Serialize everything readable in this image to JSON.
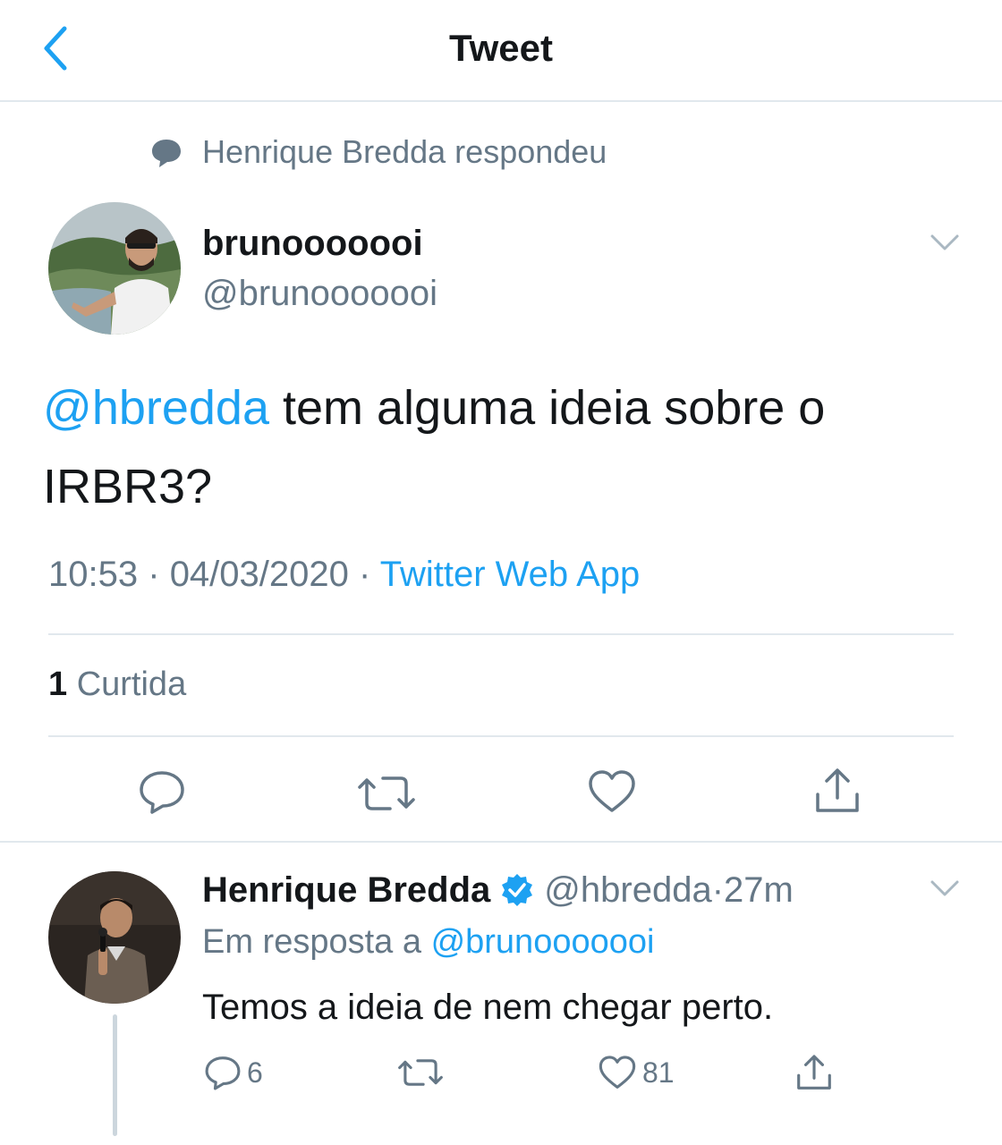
{
  "navbar": {
    "title": "Tweet"
  },
  "context": {
    "text": "Henrique Bredda respondeu"
  },
  "tweet": {
    "display_name": "brunooooooi",
    "handle": "@brunooooooi",
    "mention": "@hbredda",
    "text": " tem alguma ideia sobre o IRBR3?",
    "time": "10:53",
    "date": "04/03/2020",
    "source": "Twitter Web App",
    "likes_count": "1",
    "likes_label": "Curtida"
  },
  "reply": {
    "display_name": "Henrique Bredda",
    "handle": "@hbredda",
    "time": "27m",
    "in_reply_to_label": "Em resposta a",
    "in_reply_to_handle": "@brunooooooi",
    "text": "Temos a ideia de nem chegar perto.",
    "reply_count": "6",
    "like_count": "81"
  },
  "colors": {
    "accent": "#1da1f2",
    "secondary_text": "#657786",
    "divider": "#e1e8ed"
  },
  "icons": [
    "chevron-left-icon",
    "speech-bubble-icon",
    "chevron-down-icon",
    "reply-icon",
    "retweet-icon",
    "heart-icon",
    "share-icon",
    "verified-badge-icon"
  ]
}
